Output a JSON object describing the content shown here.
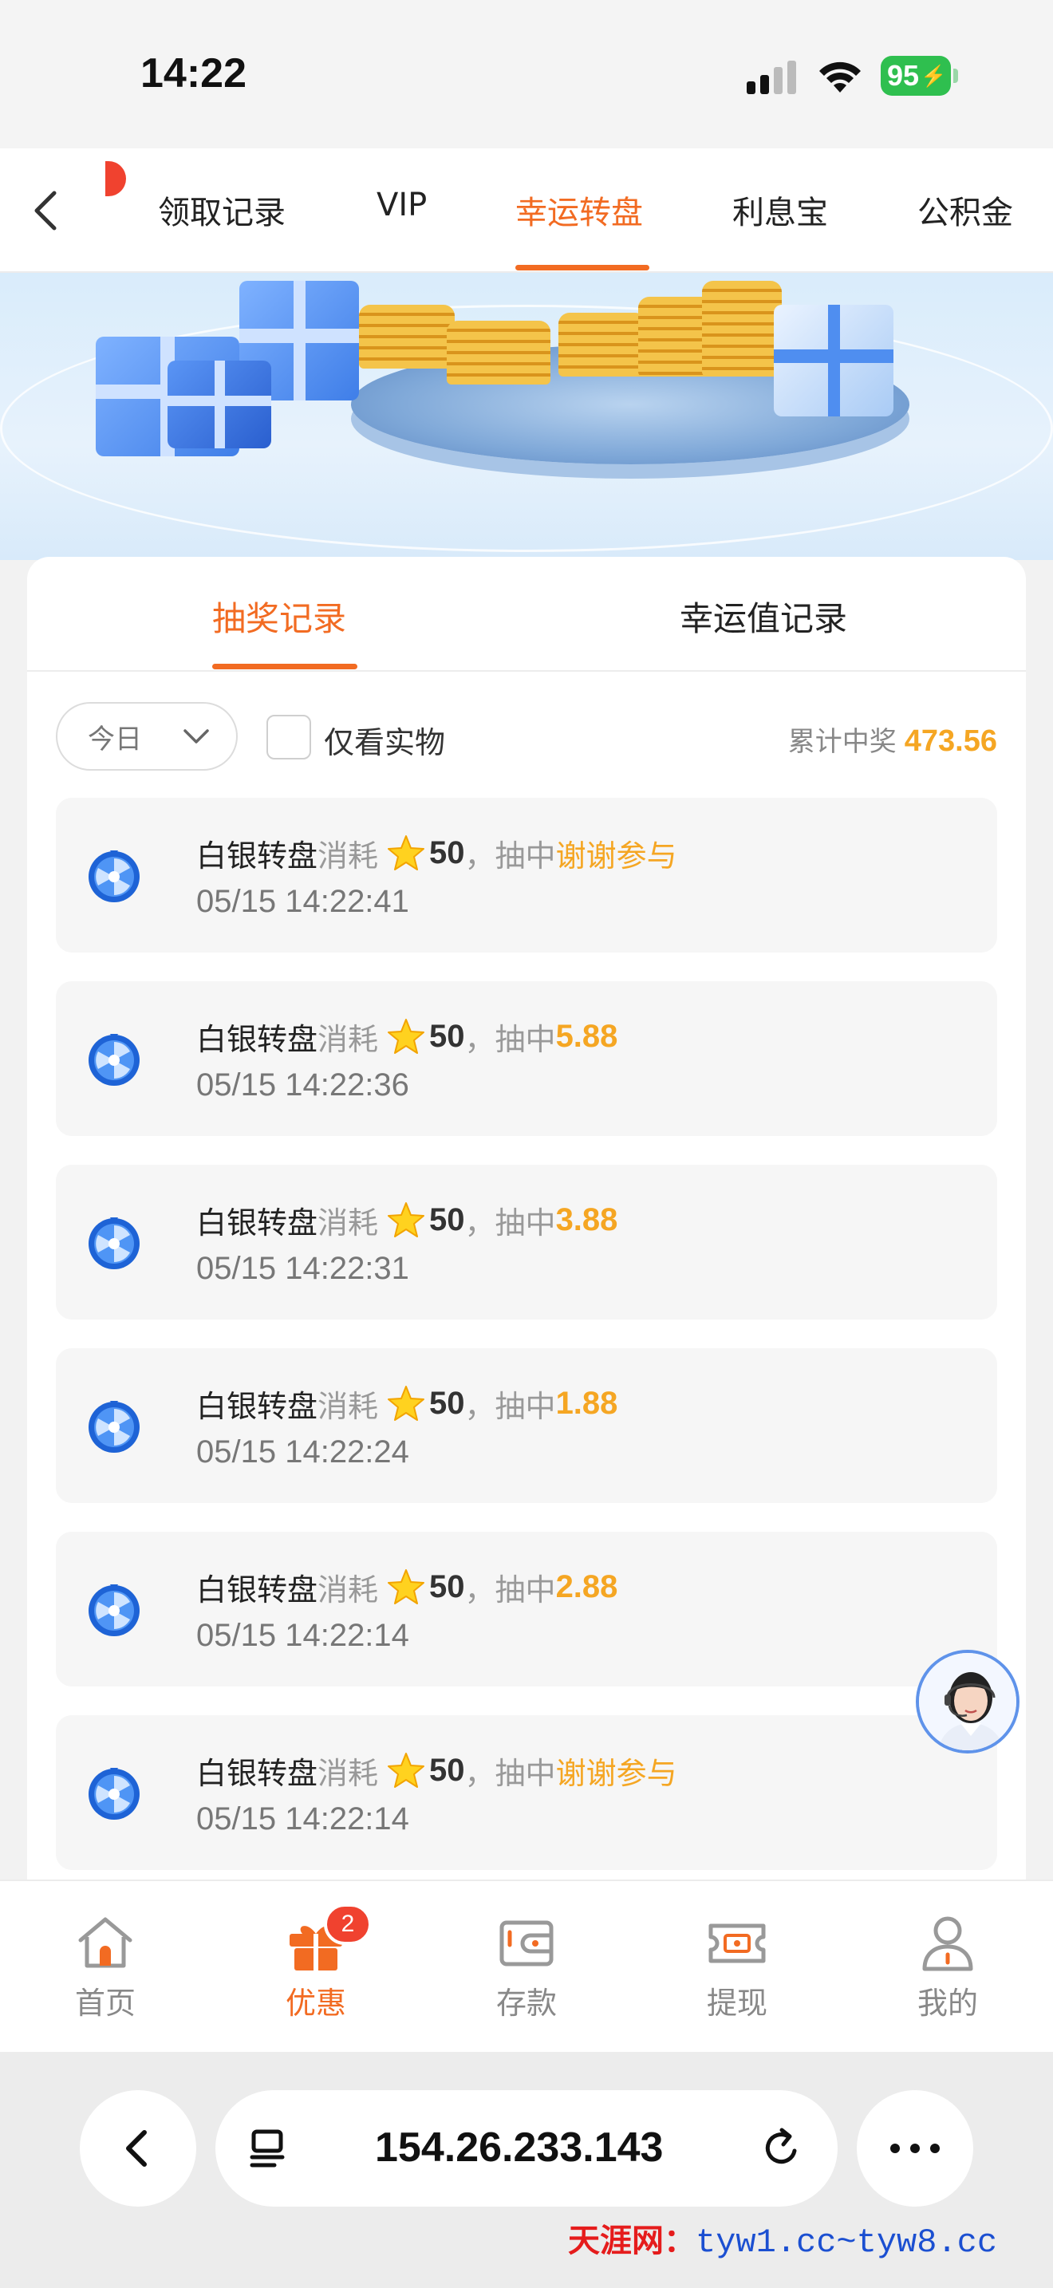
{
  "status_bar": {
    "time": "14:22",
    "battery": "95"
  },
  "top_tabs": {
    "items": [
      {
        "label": "领取记录"
      },
      {
        "label": "VIP"
      },
      {
        "label": "幸运转盘",
        "active": true
      },
      {
        "label": "利息宝"
      },
      {
        "label": "公积金"
      }
    ]
  },
  "card": {
    "tabs": [
      {
        "label": "抽奖记录",
        "active": true
      },
      {
        "label": "幸运值记录"
      }
    ],
    "filter": {
      "date_value": "今日",
      "checkbox_label": "仅看实物",
      "total_label": "累计中奖",
      "total_value": "473.56"
    },
    "records": [
      {
        "title": "白银转盘",
        "consume": "消耗",
        "cost": "50",
        "sep": "，",
        "hit": "抽中",
        "prize": "谢谢参与",
        "time": "05/15 14:22:41"
      },
      {
        "title": "白银转盘",
        "consume": "消耗",
        "cost": "50",
        "sep": "，",
        "hit": "抽中",
        "prize": "5.88",
        "time": "05/15 14:22:36"
      },
      {
        "title": "白银转盘",
        "consume": "消耗",
        "cost": "50",
        "sep": "，",
        "hit": "抽中",
        "prize": "3.88",
        "time": "05/15 14:22:31"
      },
      {
        "title": "白银转盘",
        "consume": "消耗",
        "cost": "50",
        "sep": "，",
        "hit": "抽中",
        "prize": "1.88",
        "time": "05/15 14:22:24"
      },
      {
        "title": "白银转盘",
        "consume": "消耗",
        "cost": "50",
        "sep": "，",
        "hit": "抽中",
        "prize": "2.88",
        "time": "05/15 14:22:14"
      },
      {
        "title": "白银转盘",
        "consume": "消耗",
        "cost": "50",
        "sep": "，",
        "hit": "抽中",
        "prize": "谢谢参与",
        "time": "05/15 14:22:14"
      }
    ]
  },
  "bottom_nav": {
    "items": [
      {
        "label": "首页",
        "icon": "home-icon"
      },
      {
        "label": "优惠",
        "icon": "gift-icon",
        "active": true,
        "badge": "2"
      },
      {
        "label": "存款",
        "icon": "wallet-icon"
      },
      {
        "label": "提现",
        "icon": "withdraw-icon"
      },
      {
        "label": "我的",
        "icon": "user-icon"
      }
    ]
  },
  "browser": {
    "url": "154.26.233.143"
  },
  "watermark": {
    "site_name": "天涯网：",
    "site_urls": "tyw1.cc~tyw8.cc"
  },
  "colors": {
    "accent": "#f26b22",
    "prize": "#f5a623",
    "badge": "#f0422f"
  }
}
